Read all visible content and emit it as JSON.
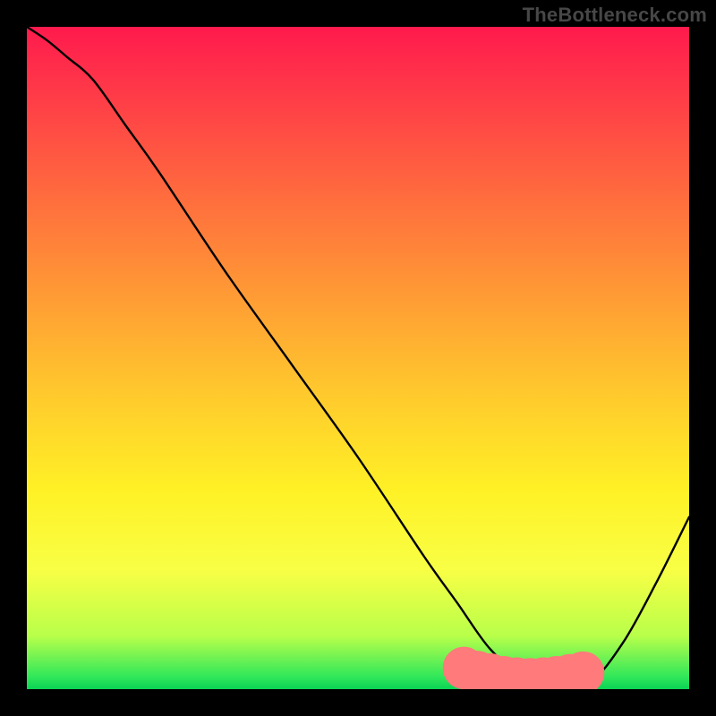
{
  "watermark": "TheBottleneck.com",
  "chart_data": {
    "type": "line",
    "title": "",
    "xlabel": "",
    "ylabel": "",
    "xlim": [
      0,
      100
    ],
    "ylim": [
      0,
      100
    ],
    "grid": false,
    "legend": false,
    "background_gradient_stops": [
      {
        "pos": 0,
        "color": "#ff1a4d"
      },
      {
        "pos": 10,
        "color": "#ff3a48"
      },
      {
        "pos": 25,
        "color": "#ff6a3e"
      },
      {
        "pos": 40,
        "color": "#ff9935"
      },
      {
        "pos": 55,
        "color": "#ffc82d"
      },
      {
        "pos": 70,
        "color": "#fff126"
      },
      {
        "pos": 82,
        "color": "#f8ff45"
      },
      {
        "pos": 92,
        "color": "#b8ff4a"
      },
      {
        "pos": 98,
        "color": "#34e85a"
      },
      {
        "pos": 100,
        "color": "#0ad455"
      }
    ],
    "series": [
      {
        "name": "bottleneck-curve",
        "color": "#000000",
        "x": [
          0,
          3,
          6,
          10,
          15,
          20,
          30,
          40,
          50,
          60,
          65,
          70,
          75,
          80,
          85,
          90,
          95,
          100
        ],
        "y": [
          100,
          98,
          95.5,
          92,
          85,
          78,
          63,
          49,
          35,
          20,
          13,
          6,
          2,
          0.5,
          1,
          7,
          16,
          26
        ]
      }
    ],
    "flat_region_markers": {
      "color": "#ff7a7a",
      "radius": 3.2,
      "x": [
        66,
        68,
        70,
        72,
        74,
        76,
        78,
        80,
        82,
        84
      ],
      "y": [
        3.2,
        2.6,
        2.2,
        1.8,
        1.6,
        1.5,
        1.6,
        1.8,
        2.1,
        2.5
      ]
    }
  }
}
